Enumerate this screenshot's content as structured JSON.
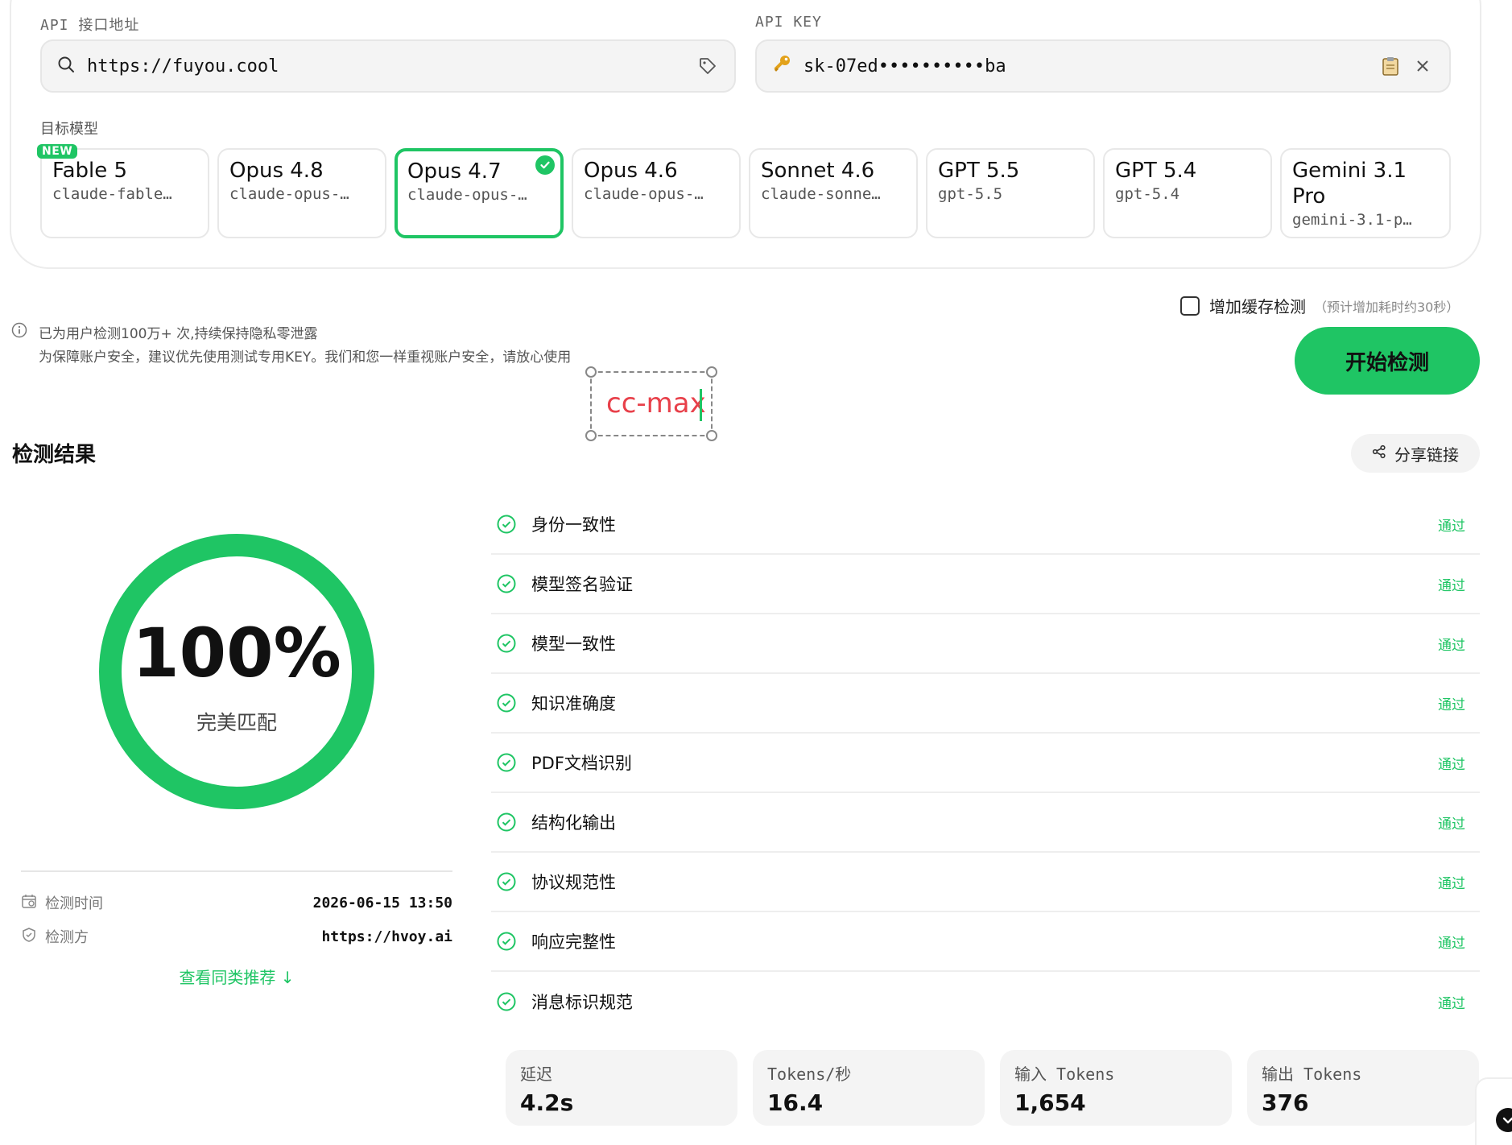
{
  "api": {
    "url_label": "API 接口地址",
    "url_value": "https://fuyou.cool",
    "key_label": "API KEY",
    "key_value": "sk-07ed••••••••••ba"
  },
  "models": {
    "label": "目标模型",
    "new_badge": "NEW",
    "items": [
      {
        "name": "Fable 5",
        "id": "claude-fable…"
      },
      {
        "name": "Opus 4.8",
        "id": "claude-opus-…"
      },
      {
        "name": "Opus 4.7",
        "id": "claude-opus-…"
      },
      {
        "name": "Opus 4.6",
        "id": "claude-opus-…"
      },
      {
        "name": "Sonnet 4.6",
        "id": "claude-sonne…"
      },
      {
        "name": "GPT 5.5",
        "id": "gpt-5.5"
      },
      {
        "name": "GPT 5.4",
        "id": "gpt-5.4"
      },
      {
        "name": "Gemini 3.1 Pro",
        "id": "gemini-3.1-p…"
      }
    ],
    "selected_index": 2
  },
  "cache": {
    "label": "增加缓存检测",
    "hint": "（预计增加耗时约30秒）",
    "checked": false
  },
  "start_button": "开始检测",
  "notice": {
    "line1": "已为用户检测100万+ 次,持续保持隐私零泄露",
    "line2": "为保障账户安全，建议优先使用测试专用KEY。我们和您一样重视账户安全，请放心使用"
  },
  "annotation": {
    "text": "cc-max"
  },
  "results": {
    "title": "检测结果",
    "share": "分享链接",
    "score": "100%",
    "score_fraction": 1.0,
    "score_label": "完美匹配",
    "time_label": "检测时间",
    "time_value": "2026-06-15 13:50",
    "checker_label": "检测方",
    "checker_value": "https://hvoy.ai",
    "see_more": "查看同类推荐 ↓",
    "checks": [
      {
        "label": "身份一致性",
        "status": "通过"
      },
      {
        "label": "模型签名验证",
        "status": "通过"
      },
      {
        "label": "模型一致性",
        "status": "通过"
      },
      {
        "label": "知识准确度",
        "status": "通过"
      },
      {
        "label": "PDF文档识别",
        "status": "通过"
      },
      {
        "label": "结构化输出",
        "status": "通过"
      },
      {
        "label": "协议规范性",
        "status": "通过"
      },
      {
        "label": "响应完整性",
        "status": "通过"
      },
      {
        "label": "消息标识规范",
        "status": "通过"
      }
    ]
  },
  "stats": [
    {
      "label": "延迟",
      "value": "4.2s"
    },
    {
      "label": "Tokens/秒",
      "value": "16.4"
    },
    {
      "label": "输入 Tokens",
      "value": "1,654"
    },
    {
      "label": "输出 Tokens",
      "value": "376"
    }
  ],
  "colors": {
    "accent": "#1fc564",
    "annotation_text": "#e8404a"
  },
  "icons": [
    "search-icon",
    "tag-icon",
    "key-icon",
    "clipboard-icon",
    "close-icon",
    "check-icon",
    "info-icon",
    "share-icon",
    "calendar-icon",
    "shield-icon",
    "check-circle-icon"
  ]
}
